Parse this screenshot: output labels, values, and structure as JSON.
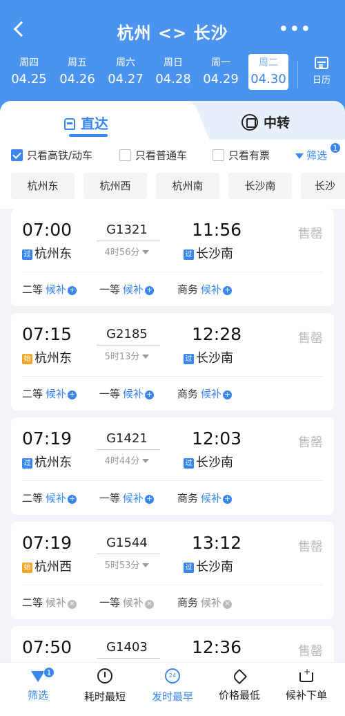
{
  "nav": {
    "title": "杭州 <> 长沙",
    "more": "•••"
  },
  "dates": [
    {
      "weekday": "周四",
      "date": "04.25"
    },
    {
      "weekday": "周五",
      "date": "04.26"
    },
    {
      "weekday": "周六",
      "date": "04.27"
    },
    {
      "weekday": "周日",
      "date": "04.28"
    },
    {
      "weekday": "周一",
      "date": "04.29"
    },
    {
      "weekday": "周二",
      "date": "04.30",
      "selected": true
    }
  ],
  "calendar_label": "日历",
  "tabs": {
    "direct": "直达",
    "transfer": "中转"
  },
  "filters": {
    "high_speed": {
      "label": "只看高铁/动车",
      "checked": true
    },
    "regular": {
      "label": "只看普通车",
      "checked": false
    },
    "available": {
      "label": "只看有票",
      "checked": false
    },
    "filter_btn": "筛选",
    "filter_badge": "1"
  },
  "stations": [
    "杭州东",
    "杭州西",
    "杭州南",
    "长沙南",
    "长沙"
  ],
  "trains": [
    {
      "dep_time": "07:00",
      "train_no": "G1321",
      "arr_time": "11:56",
      "duration": "4时56分",
      "dep_tag": "过",
      "dep_station": "杭州东",
      "arr_tag": "过",
      "arr_station": "长沙南",
      "status": "售罄",
      "seats": [
        {
          "name": "二等",
          "waitlist": "候补",
          "available": true
        },
        {
          "name": "一等",
          "waitlist": "候补",
          "available": true
        },
        {
          "name": "商务",
          "waitlist": "候补",
          "available": true
        }
      ]
    },
    {
      "dep_time": "07:15",
      "train_no": "G2185",
      "arr_time": "12:28",
      "duration": "5时13分",
      "dep_tag": "始",
      "dep_station": "杭州东",
      "arr_tag": "过",
      "arr_station": "长沙南",
      "status": "售罄",
      "seats": [
        {
          "name": "二等",
          "waitlist": "候补",
          "available": true
        },
        {
          "name": "一等",
          "waitlist": "候补",
          "available": true
        },
        {
          "name": "商务",
          "waitlist": "候补",
          "available": true
        }
      ]
    },
    {
      "dep_time": "07:19",
      "train_no": "G1421",
      "arr_time": "12:03",
      "duration": "4时44分",
      "dep_tag": "过",
      "dep_station": "杭州东",
      "arr_tag": "过",
      "arr_station": "长沙南",
      "status": "售罄",
      "seats": [
        {
          "name": "二等",
          "waitlist": "候补",
          "available": true
        },
        {
          "name": "一等",
          "waitlist": "候补",
          "available": true
        },
        {
          "name": "商务",
          "waitlist": "候补",
          "available": true
        }
      ]
    },
    {
      "dep_time": "07:19",
      "train_no": "G1544",
      "arr_time": "13:12",
      "duration": "5时53分",
      "dep_tag": "始",
      "dep_station": "杭州西",
      "arr_tag": "过",
      "arr_station": "长沙南",
      "status": "售罄",
      "seats": [
        {
          "name": "二等",
          "waitlist": "候补",
          "available": false
        },
        {
          "name": "一等",
          "waitlist": "候补",
          "available": false
        },
        {
          "name": "商务",
          "waitlist": "候补",
          "available": false
        }
      ]
    },
    {
      "dep_time": "07:50",
      "train_no": "G1403",
      "arr_time": "12:36",
      "duration": "",
      "dep_tag": "",
      "dep_station": "",
      "arr_tag": "",
      "arr_station": "",
      "status": "售罄",
      "seats": []
    }
  ],
  "bottom_bar": [
    {
      "label": "筛选",
      "icon": "funnel-icon",
      "badge": "1",
      "active": true
    },
    {
      "label": "耗时最短",
      "icon": "stopwatch-icon",
      "active": false
    },
    {
      "label": "发时最早",
      "icon": "clock-24-icon",
      "active": true
    },
    {
      "label": "价格最低",
      "icon": "price-tag-icon",
      "active": false
    },
    {
      "label": "候补下单",
      "icon": "cart-icon",
      "active": false
    }
  ],
  "colors": {
    "primary": "#3a86ee",
    "header": "#4a93ef",
    "origin_tag": "#f5a623",
    "sold_out": "#bbbbbb"
  }
}
